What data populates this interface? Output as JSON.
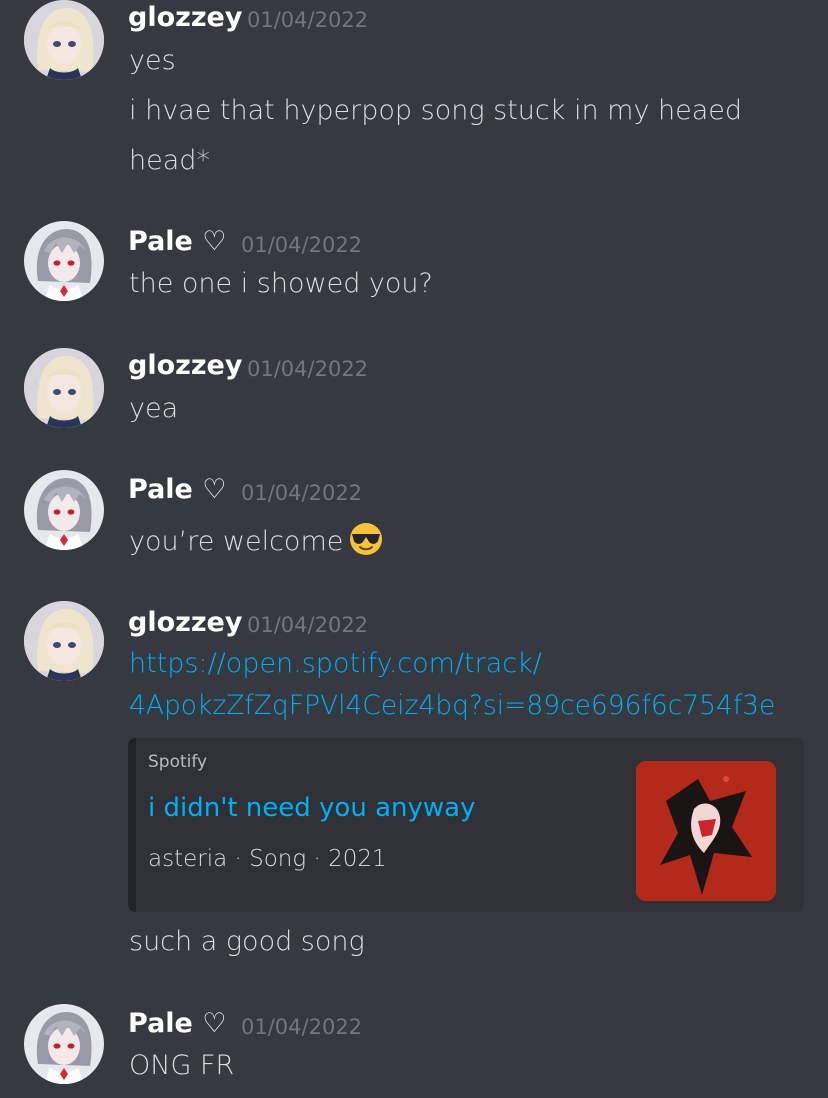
{
  "messages": [
    {
      "author": "glozzey",
      "timestamp": "01/04/2022",
      "lines": [
        "yes",
        "i hvae that hyperpop song stuck in my heaed",
        "head*"
      ]
    },
    {
      "author": "Pale",
      "heart": "♡",
      "timestamp": "01/04/2022",
      "lines": [
        "the one i showed you?"
      ]
    },
    {
      "author": "glozzey",
      "timestamp": "01/04/2022",
      "lines": [
        "yea"
      ]
    },
    {
      "author": "Pale",
      "heart": "♡",
      "timestamp": "01/04/2022",
      "lines": [
        "you’re welcome"
      ]
    },
    {
      "author": "glozzey",
      "timestamp": "01/04/2022",
      "link_lines": [
        "https://open.spotify.com/track/",
        "4ApokzZfZqFPVl4Ceiz4bq?si=89ce696f6c754f3e"
      ],
      "embed": {
        "provider": "Spotify",
        "title": "i didn't need you anyway",
        "description": "asteria · Song · 2021"
      },
      "after": "such a good song"
    },
    {
      "author": "Pale",
      "heart": "♡",
      "timestamp": "01/04/2022",
      "lines": [
        "ONG FR"
      ]
    }
  ],
  "colors": {
    "background": "#36393f",
    "link": "#00aff4",
    "timestamp": "#72767d",
    "embed_bg": "#2f3136",
    "embed_border": "#202225"
  },
  "icons": {
    "sunglasses_emoji": "sunglasses-emoji-icon"
  }
}
